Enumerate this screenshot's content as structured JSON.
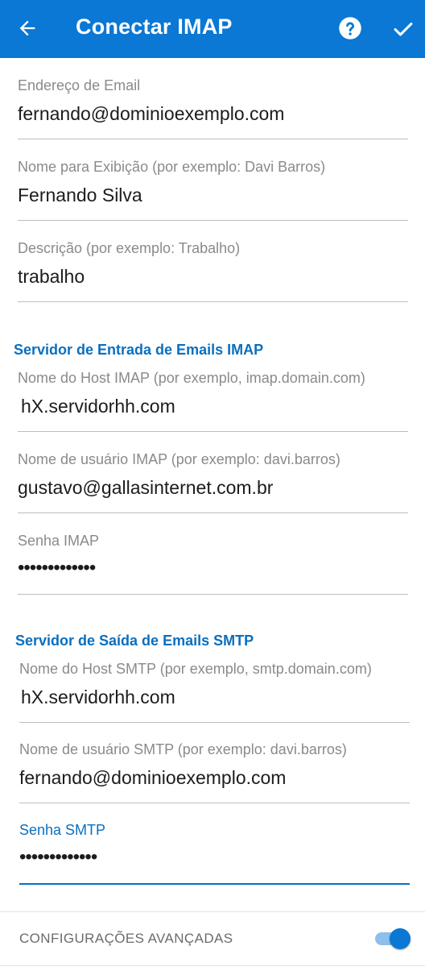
{
  "appbar": {
    "title": "Conectar IMAP",
    "back_icon": "arrow-left-icon",
    "help_icon": "help-circle-icon",
    "confirm_icon": "check-icon",
    "background": "#0a78d4"
  },
  "account": {
    "email": {
      "label": "Endereço de Email",
      "value": "fernando@dominioexemplo.com"
    },
    "display_name": {
      "label": "Nome para Exibição (por exemplo: Davi Barros)",
      "value": "Fernando Silva"
    },
    "description": {
      "label": "Descrição (por exemplo: Trabalho)",
      "value": "trabalho"
    }
  },
  "imap": {
    "section_title": "Servidor de Entrada de Emails IMAP",
    "host": {
      "label": "Nome do Host IMAP (por exemplo, imap.domain.com)",
      "value": "hX.servidorhh.com"
    },
    "username": {
      "label": "Nome de usuário IMAP (por exemplo: davi.barros)",
      "value": "gustavo@gallasinternet.com.br"
    },
    "password": {
      "label": "Senha IMAP",
      "value": "•••••••••••••"
    }
  },
  "smtp": {
    "section_title": "Servidor de Saída de Emails SMTP",
    "host": {
      "label": "Nome do Host SMTP (por exemplo, smtp.domain.com)",
      "value": "hX.servidorhh.com"
    },
    "username": {
      "label": "Nome de usuário SMTP (por exemplo: davi.barros)",
      "value": "fernando@dominioexemplo.com"
    },
    "password": {
      "label": "Senha SMTP",
      "value": "•••••••••••••",
      "focused": true
    }
  },
  "advanced": {
    "label": "CONFIGURAÇÕES AVANÇADAS",
    "enabled": true,
    "accent": "#0a78d4"
  }
}
